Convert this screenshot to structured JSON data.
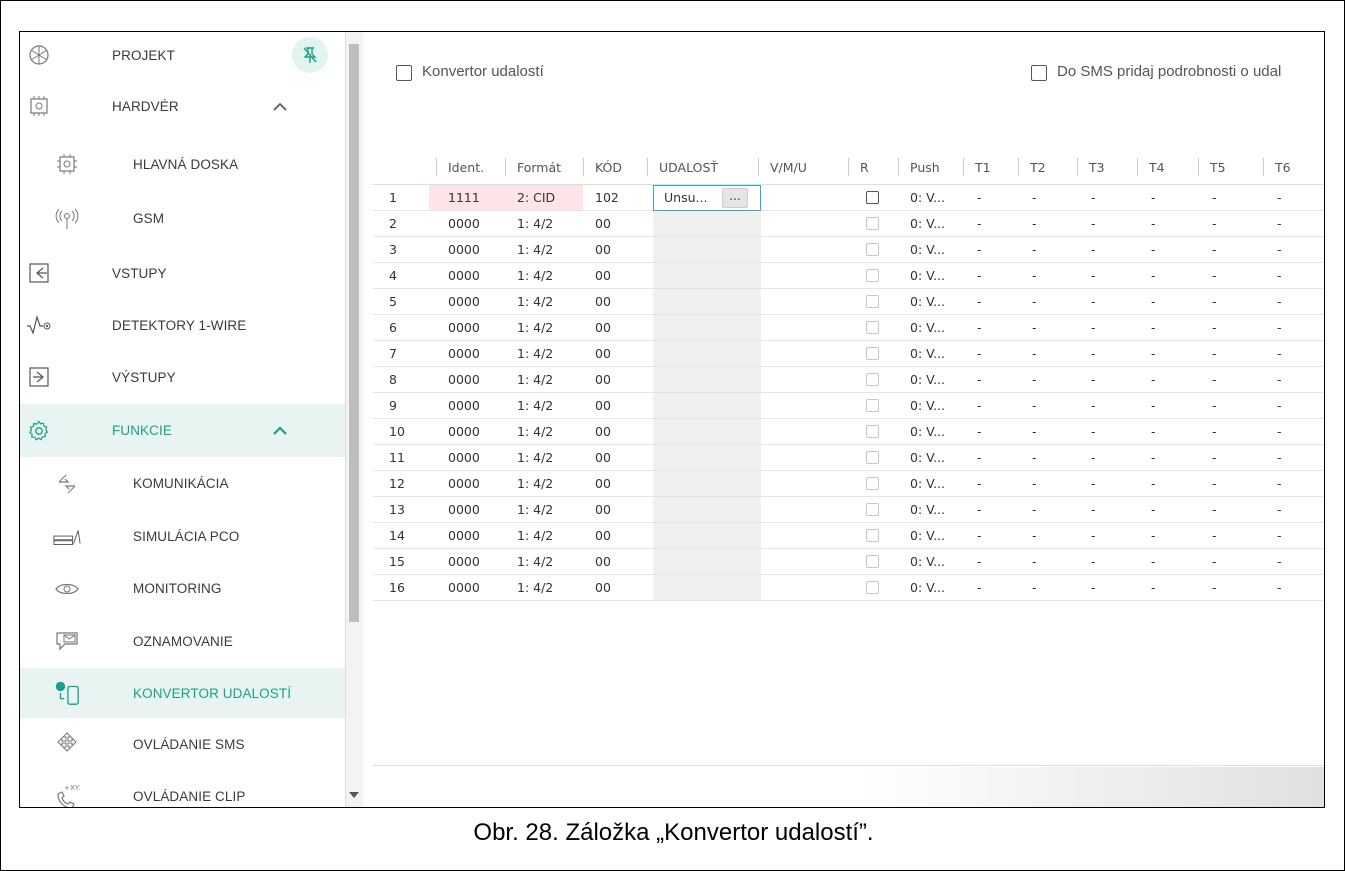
{
  "sidebar": {
    "items": [
      {
        "label": "PROJEKT",
        "icon": "project-icon"
      },
      {
        "label": "HARDVÉR",
        "icon": "hardware-icon"
      },
      {
        "label": "HLAVNÁ DOSKA",
        "icon": "mainboard-icon"
      },
      {
        "label": "GSM",
        "icon": "gsm-icon"
      },
      {
        "label": "VSTUPY",
        "icon": "inputs-icon"
      },
      {
        "label": "DETEKTORY 1-WIRE",
        "icon": "detectors-icon"
      },
      {
        "label": "VÝSTUPY",
        "icon": "outputs-icon"
      },
      {
        "label": "FUNKCIE",
        "icon": "gear-icon"
      },
      {
        "label": "KOMUNIKÁCIA",
        "icon": "communication-icon"
      },
      {
        "label": "SIMULÁCIA PCO",
        "icon": "simulation-icon"
      },
      {
        "label": "MONITORING",
        "icon": "eye-icon"
      },
      {
        "label": "OZNAMOVANIE",
        "icon": "notification-icon"
      },
      {
        "label": "KONVERTOR UDALOSTÍ",
        "icon": "converter-icon"
      },
      {
        "label": "OVLÁDANIE SMS",
        "icon": "sms-control-icon"
      },
      {
        "label": "OVLÁDANIE CLIP",
        "icon": "clip-control-icon"
      }
    ]
  },
  "main": {
    "converter_checkbox_label": "Konvertor udalostí",
    "sms_details_checkbox_label": "Do SMS pridaj podrobnosti o udal",
    "columns": [
      "",
      "Ident.",
      "Formát",
      "KÓD",
      "UDALOSŤ",
      "V/M/U",
      "R",
      "Push",
      "T1",
      "T2",
      "T3",
      "T4",
      "T5",
      "T6"
    ],
    "rows": [
      {
        "n": "1",
        "ident": "1111",
        "format": "2: CID",
        "code": "102",
        "event": "Unsu...",
        "push": "0: V..."
      },
      {
        "n": "2",
        "ident": "0000",
        "format": "1: 4/2",
        "code": "00",
        "event": "",
        "push": "0: V..."
      },
      {
        "n": "3",
        "ident": "0000",
        "format": "1: 4/2",
        "code": "00",
        "event": "",
        "push": "0: V..."
      },
      {
        "n": "4",
        "ident": "0000",
        "format": "1: 4/2",
        "code": "00",
        "event": "",
        "push": "0: V..."
      },
      {
        "n": "5",
        "ident": "0000",
        "format": "1: 4/2",
        "code": "00",
        "event": "",
        "push": "0: V..."
      },
      {
        "n": "6",
        "ident": "0000",
        "format": "1: 4/2",
        "code": "00",
        "event": "",
        "push": "0: V..."
      },
      {
        "n": "7",
        "ident": "0000",
        "format": "1: 4/2",
        "code": "00",
        "event": "",
        "push": "0: V..."
      },
      {
        "n": "8",
        "ident": "0000",
        "format": "1: 4/2",
        "code": "00",
        "event": "",
        "push": "0: V..."
      },
      {
        "n": "9",
        "ident": "0000",
        "format": "1: 4/2",
        "code": "00",
        "event": "",
        "push": "0: V..."
      },
      {
        "n": "10",
        "ident": "0000",
        "format": "1: 4/2",
        "code": "00",
        "event": "",
        "push": "0: V..."
      },
      {
        "n": "11",
        "ident": "0000",
        "format": "1: 4/2",
        "code": "00",
        "event": "",
        "push": "0: V..."
      },
      {
        "n": "12",
        "ident": "0000",
        "format": "1: 4/2",
        "code": "00",
        "event": "",
        "push": "0: V..."
      },
      {
        "n": "13",
        "ident": "0000",
        "format": "1: 4/2",
        "code": "00",
        "event": "",
        "push": "0: V..."
      },
      {
        "n": "14",
        "ident": "0000",
        "format": "1: 4/2",
        "code": "00",
        "event": "",
        "push": "0: V..."
      },
      {
        "n": "15",
        "ident": "0000",
        "format": "1: 4/2",
        "code": "00",
        "event": "",
        "push": "0: V..."
      },
      {
        "n": "16",
        "ident": "0000",
        "format": "1: 4/2",
        "code": "00",
        "event": "",
        "push": "0: V..."
      }
    ],
    "dash": "-",
    "event_button_label": "..."
  },
  "caption": "Obr. 28. Záložka „Konvertor udalostí”.",
  "colors": {
    "accent": "#1aa08a",
    "active_bg": "#e8f4f2",
    "error_cell": "#fde4e6",
    "focus_border": "#36a9c6"
  }
}
